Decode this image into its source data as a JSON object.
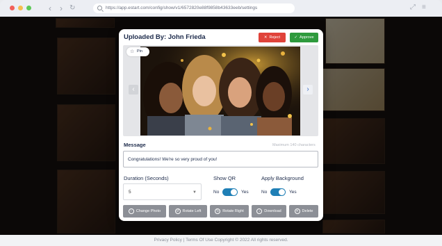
{
  "browser": {
    "url": "https://app.estart.com/config/show/v1/6572820e88f9858b43633eeb/settings"
  },
  "footer": {
    "text": "Privacy Policy | Terms Of Use  Copyright © 2022 All rights reserved."
  },
  "modal": {
    "title": "Uploaded By: John Frieda",
    "reject_label": "Reject",
    "approve_label": "Approve",
    "pin_label": "Pin",
    "message_label": "Message",
    "message_hint": "Maximum 140 characters",
    "message_value": "Congratulations! We're so very proud of you!",
    "duration_label": "Duration (Seconds)",
    "duration_value": "5",
    "show_qr_label": "Show QR",
    "show_qr": {
      "off": "No",
      "on": "Yes",
      "value": true
    },
    "apply_bg_label": "Apply Background",
    "apply_bg": {
      "off": "No",
      "on": "Yes",
      "value": true
    },
    "actions": [
      {
        "label": "Change Photo",
        "icon": "upload-icon"
      },
      {
        "label": "Rotate Left",
        "icon": "rotate-left-icon"
      },
      {
        "label": "Rotate Right",
        "icon": "rotate-right-icon"
      },
      {
        "label": "Download",
        "icon": "download-icon"
      },
      {
        "label": "Delete",
        "icon": "trash-icon"
      }
    ]
  },
  "colors": {
    "reject": "#e0433a",
    "approve": "#2e9a3d",
    "toggle": "#1f7fb6",
    "action": "#8c8f96"
  }
}
